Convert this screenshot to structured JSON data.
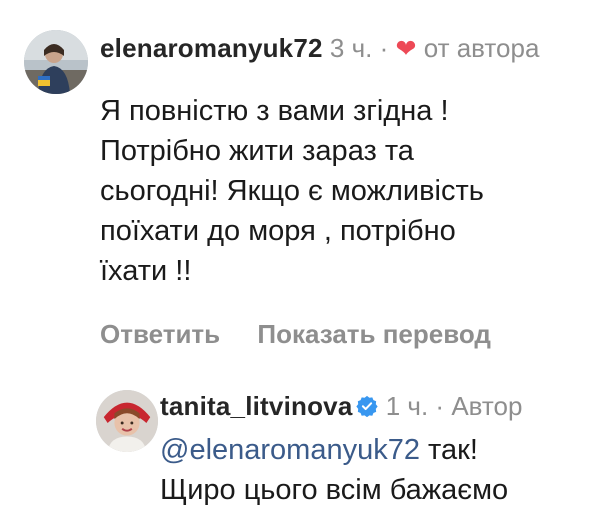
{
  "comments": [
    {
      "username": "elenaromanyuk72",
      "time": "3 ч.",
      "separator": "·",
      "liked_by_author_label": "от автора",
      "text": "Я повністю з вами згідна !\nПотрібно жити зараз та\nсьогодні! Якщо є можливість\nпоїхати до моря , потрібно\nїхати !!",
      "actions": {
        "reply": "Ответить",
        "translate": "Показать перевод"
      },
      "colors": {
        "heart": "#ed4956"
      },
      "icons": [
        "avatar",
        "heart-icon"
      ]
    },
    {
      "username": "tanita_litvinova",
      "time": "1 ч.",
      "separator": "·",
      "author_badge": "Автор",
      "mention": "@elenaromanyuk72",
      "text_after_mention": " так!",
      "text_line2": "Щиро цього всім бажаємо",
      "colors": {
        "verified": "#3897f0",
        "mention": "#3b5b8a"
      },
      "icons": [
        "avatar",
        "verified-badge-icon"
      ]
    }
  ]
}
